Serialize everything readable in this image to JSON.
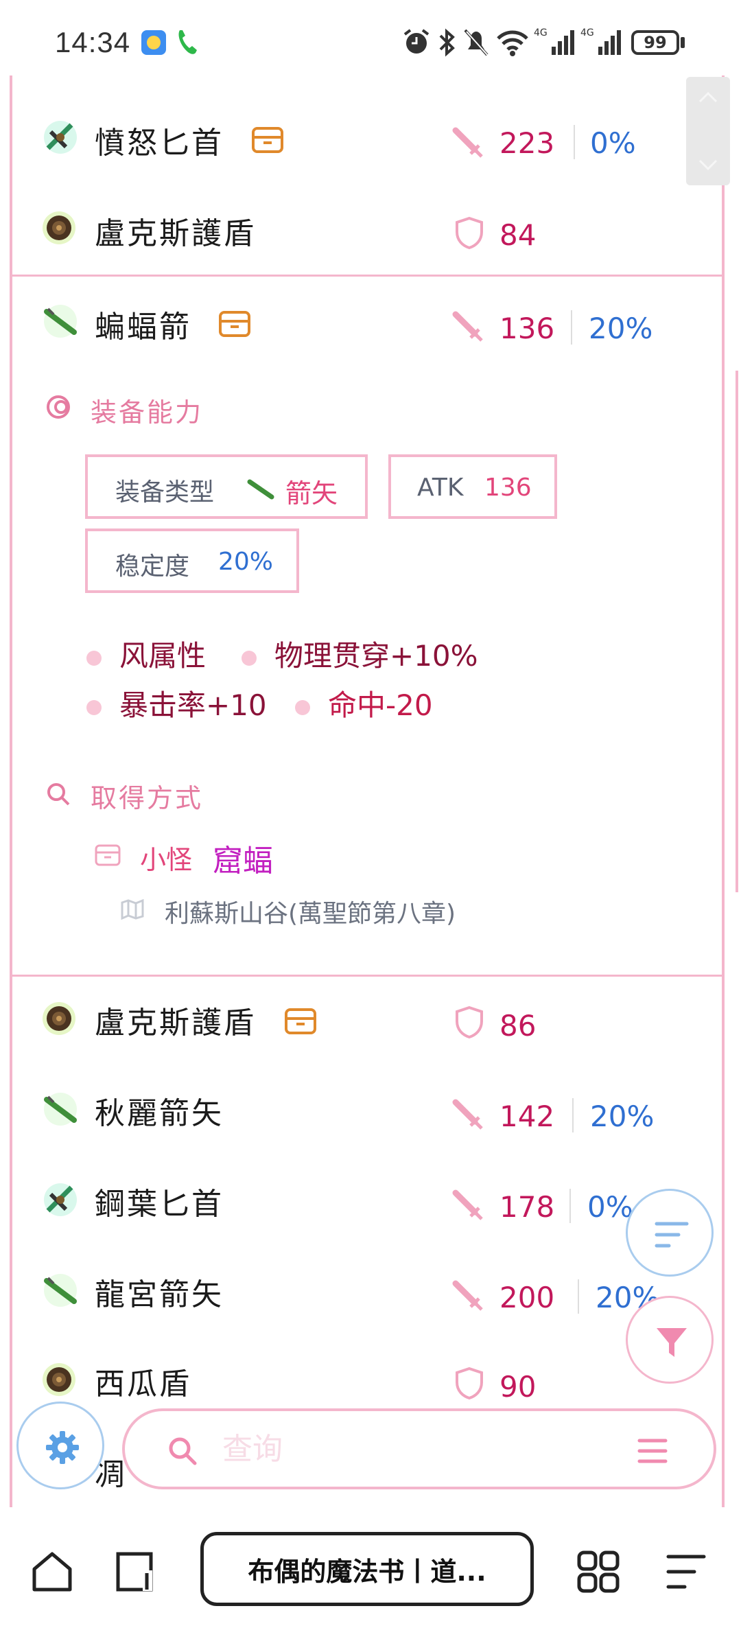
{
  "status_bar": {
    "time": "14:34",
    "battery": "99",
    "network_label": "4G"
  },
  "items": [
    {
      "name": "憤怒匕首",
      "icon": "dagger-icon",
      "has_box": true,
      "stat_type": "atk",
      "value": "223",
      "pct": "0%"
    },
    {
      "name": "盧克斯護盾",
      "icon": "shield-item-icon",
      "has_box": false,
      "stat_type": "def",
      "value": "84"
    },
    {
      "name": "蝙蝠箭",
      "icon": "arrow-item-icon",
      "has_box": true,
      "stat_type": "atk",
      "value": "136",
      "pct": "20%"
    },
    {
      "name": "盧克斯護盾",
      "icon": "shield-item-icon",
      "has_box": true,
      "stat_type": "def",
      "value": "86"
    },
    {
      "name": "秋麗箭矢",
      "icon": "arrow-item-icon",
      "has_box": false,
      "stat_type": "atk",
      "value": "142",
      "pct": "20%"
    },
    {
      "name": "鋼葉匕首",
      "icon": "dagger-icon",
      "has_box": false,
      "stat_type": "atk",
      "value": "178",
      "pct": "0%"
    },
    {
      "name": "龍宮箭矢",
      "icon": "arrow-item-icon",
      "has_box": false,
      "stat_type": "atk",
      "value": "200",
      "pct": "20%"
    },
    {
      "name": "西瓜盾",
      "icon": "shield-item-icon",
      "has_box": false,
      "stat_type": "def",
      "value": "90"
    },
    {
      "name": "凋",
      "icon": "",
      "has_box": false,
      "stat_type": "",
      "value": ""
    }
  ],
  "detail": {
    "ability_title": "装备能力",
    "type_label": "装备类型",
    "type_value": "箭矢",
    "atk_label": "ATK",
    "atk_value": "136",
    "stability_label": "稳定度",
    "stability_value": "20%",
    "attributes": [
      "风属性",
      "物理贯穿+10%",
      "暴击率+10",
      "命中-20"
    ],
    "acquire_title": "取得方式",
    "acquire_type": "小怪",
    "acquire_monster": "窟蝠",
    "acquire_location": "利蘇斯山谷(萬聖節第八章)"
  },
  "search": {
    "placeholder": "查询"
  },
  "browser": {
    "tab_title": "布偶的魔法书丨道..."
  },
  "colors": {
    "accent_pink": "#e57ba0",
    "border_pink": "#f4b6cc",
    "atk_red": "#c2185b",
    "pct_blue": "#2f6fd1",
    "box_orange": "#e0892b",
    "monster_purple": "#c21fc0"
  }
}
